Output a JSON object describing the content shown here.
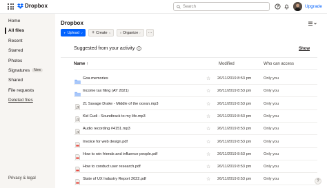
{
  "header": {
    "logo_text": "Dropbox",
    "search_placeholder": "Search",
    "upgrade_label": "Upgrade"
  },
  "sidebar": {
    "items": [
      {
        "label": "Home"
      },
      {
        "label": "All files"
      },
      {
        "label": "Recent"
      },
      {
        "label": "Starred"
      },
      {
        "label": "Photos"
      },
      {
        "label": "Signatures",
        "badge": "New"
      },
      {
        "label": "Shared"
      },
      {
        "label": "File requests"
      },
      {
        "label": "Deleted files"
      }
    ],
    "footer": "Privacy & legal"
  },
  "main": {
    "title": "Dropbox",
    "toolbar": {
      "upload_label": "Upload",
      "create_label": "Create",
      "organize_label": "Organize",
      "more_label": "···"
    },
    "suggested_title": "Suggested from your activity",
    "show_label": "Show",
    "columns": {
      "name": "Name",
      "modified": "Modified",
      "who": "Who can access"
    },
    "files": [
      {
        "name": "Goa memories",
        "type": "folder",
        "modified": "26/11/2019 8:53 pm",
        "access": "Only you"
      },
      {
        "name": "Income tax filing (AY 2021)",
        "type": "folder",
        "modified": "26/11/2019 8:53 pm",
        "access": "Only you"
      },
      {
        "name": "21 Savage Drake - Middle of the ocean.mp3",
        "type": "audio",
        "modified": "26/11/2019 8:53 pm",
        "access": "Only you"
      },
      {
        "name": "Kid Cudi - Soundtrack to my life.mp3",
        "type": "audio",
        "modified": "26/11/2019 8:53 pm",
        "access": "Only you"
      },
      {
        "name": "Audio recording #4151.mp3",
        "type": "audio",
        "modified": "26/11/2019 8:53 pm",
        "access": "Only you"
      },
      {
        "name": "Invoice for web design.pdf",
        "type": "pdf",
        "modified": "26/11/2019 8:53 pm",
        "access": "Only you"
      },
      {
        "name": "How to win friends and influence people.pdf",
        "type": "pdf",
        "modified": "26/11/2019 8:53 pm",
        "access": "Only you"
      },
      {
        "name": "How to conduct user research.pdf",
        "type": "pdf",
        "modified": "26/11/2019 8:53 pm",
        "access": "Only you"
      },
      {
        "name": "State of UX Industry Report 2022.pdf",
        "type": "pdf",
        "modified": "26/11/2019 8:53 pm",
        "access": "Only you"
      }
    ]
  },
  "help_label": "?",
  "colors": {
    "accent": "#0061fe",
    "folder": "#8ab4f8",
    "sidebar_bg": "#f7f5f2",
    "pdf": "#e8453c"
  }
}
